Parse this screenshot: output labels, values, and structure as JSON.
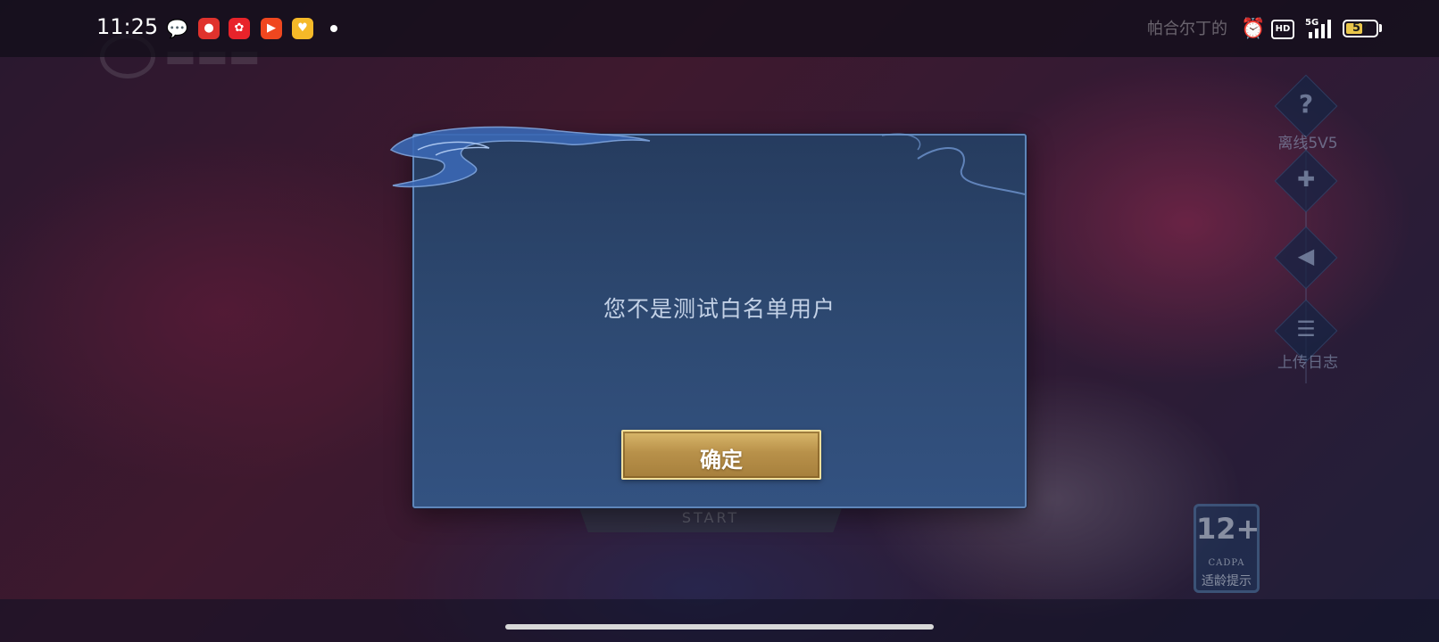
{
  "status_bar": {
    "time": "11:25",
    "notification_icons": [
      "wechat-icon",
      "pinduoduo-icon",
      "taobao-icon",
      "video-play-icon",
      "reward-icon"
    ],
    "hd_label": "HD",
    "network": "5G",
    "battery_level": "57",
    "battery_fraction": 0.57
  },
  "background": {
    "username": "帕合尔丁的"
  },
  "side_menu": {
    "items": [
      {
        "icon": "help-icon",
        "label": "离线5V5"
      },
      {
        "icon": "gamepad-icon",
        "label": ""
      },
      {
        "icon": "speaker-icon",
        "label": ""
      },
      {
        "icon": "log-icon",
        "label": "上传日志"
      }
    ]
  },
  "start_button": {
    "text": "START"
  },
  "age_rating": {
    "age": "12+",
    "org": "CADPA",
    "tip": "适龄提示"
  },
  "dialog": {
    "message": "您不是测试白名单用户",
    "confirm_label": "确定"
  },
  "colors": {
    "dialog_bg": "#2e4a73",
    "dialog_border": "#5f86ba",
    "message_text": "#c3d1e6",
    "confirm_gold": "#b8914a"
  }
}
